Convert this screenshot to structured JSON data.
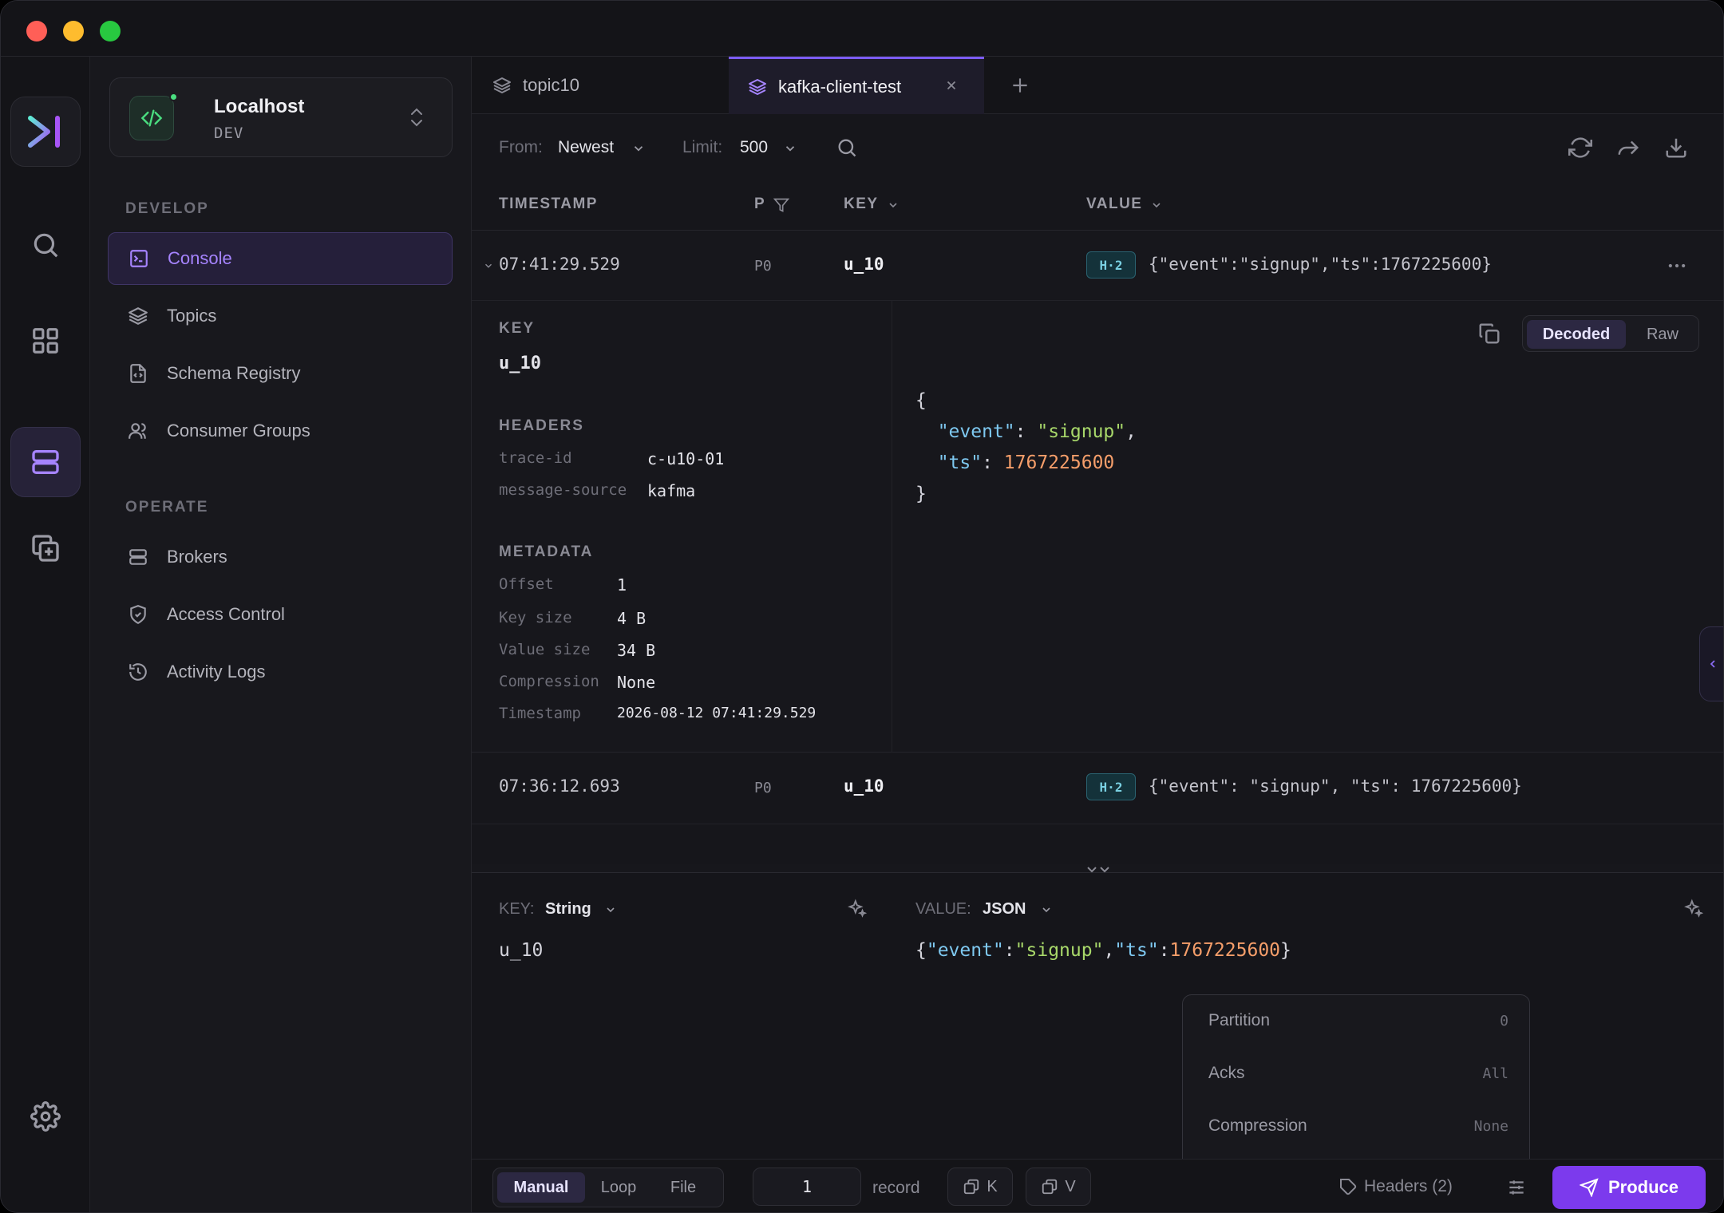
{
  "sidebar": {
    "cluster": {
      "name": "Localhost",
      "env": "DEV"
    },
    "sections": [
      {
        "title": "DEVELOP",
        "items": [
          "Console",
          "Topics",
          "Schema Registry",
          "Consumer Groups"
        ]
      },
      {
        "title": "OPERATE",
        "items": [
          "Brokers",
          "Access Control",
          "Activity Logs"
        ]
      }
    ],
    "active_item": "Console"
  },
  "tabs": [
    {
      "label": "topic10",
      "active": false
    },
    {
      "label": "kafka-client-test",
      "active": true
    }
  ],
  "toolbar": {
    "from_label": "From:",
    "from_value": "Newest",
    "limit_label": "Limit:",
    "limit_value": "500"
  },
  "table": {
    "columns": [
      "TIMESTAMP",
      "P",
      "KEY",
      "VALUE"
    ],
    "rows": [
      {
        "timestamp": "07:41:29.529",
        "partition": "P0",
        "key": "u_10",
        "headers": "H·2",
        "value": "{\"event\":\"signup\",\"ts\":1767225600}"
      },
      {
        "timestamp": "07:36:12.693",
        "partition": "P0",
        "key": "u_10",
        "headers": "H·2",
        "value": "{\"event\": \"signup\", \"ts\": 1767225600}"
      }
    ]
  },
  "detail": {
    "key_label": "KEY",
    "key": "u_10",
    "headers_label": "HEADERS",
    "headers": [
      {
        "k": "trace-id",
        "v": "c-u10-01"
      },
      {
        "k": "message-source",
        "v": "kafma"
      }
    ],
    "metadata_label": "METADATA",
    "metadata": [
      {
        "k": "Offset",
        "v": "1"
      },
      {
        "k": "Key size",
        "v": "4 B"
      },
      {
        "k": "Value size",
        "v": "34 B"
      },
      {
        "k": "Compression",
        "v": "None"
      },
      {
        "k": "Timestamp",
        "v": "2026-08-12 07:41:29.529"
      }
    ],
    "view_modes": [
      "Decoded",
      "Raw"
    ],
    "json": {
      "event_key": "\"event\"",
      "event_val": "\"signup\"",
      "ts_key": "\"ts\"",
      "ts_val": "1767225600"
    }
  },
  "producer": {
    "key_label": "KEY:",
    "key_type": "String",
    "value_label": "VALUE:",
    "value_type": "JSON",
    "key_input": "u_10",
    "value_input": {
      "event_key": "\"event\"",
      "event_val": "\"signup\"",
      "ts_key": "\"ts\"",
      "ts_val": "1767225600"
    },
    "options": [
      {
        "k": "Partition",
        "v": "0"
      },
      {
        "k": "Acks",
        "v": "All"
      },
      {
        "k": "Compression",
        "v": "None"
      }
    ],
    "modes": [
      "Manual",
      "Loop",
      "File"
    ],
    "count": "1",
    "count_unit": "record",
    "k_btn": "K",
    "v_btn": "V",
    "headers_btn": "Headers (2)",
    "produce_btn": "Produce"
  },
  "colors": {
    "accent": "#7c3aed",
    "json_key": "#7ec8f0",
    "json_string": "#a8d86a",
    "json_number": "#f59e6a"
  }
}
